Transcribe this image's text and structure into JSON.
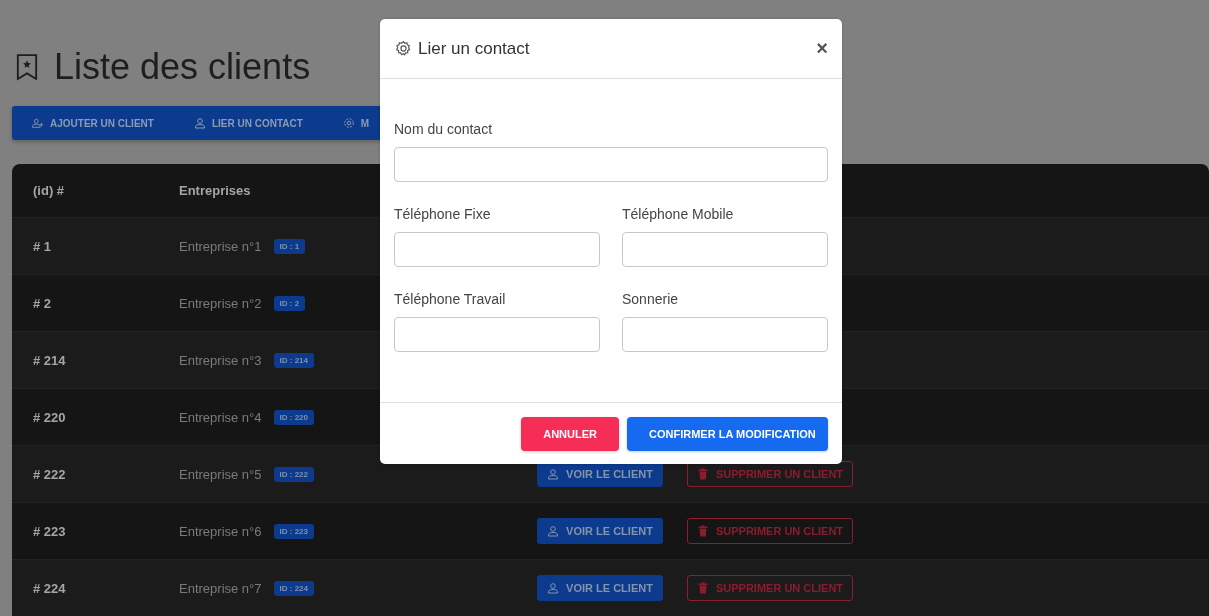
{
  "page": {
    "title": "Liste des clients"
  },
  "toolbar": [
    {
      "kind": "add-user",
      "label": "AJOUTER UN CLIENT"
    },
    {
      "kind": "user",
      "label": "LIER UN CONTACT"
    },
    {
      "kind": "gear",
      "label": "M"
    }
  ],
  "table": {
    "columns": [
      "(id) #",
      "Entreprises"
    ],
    "rows": [
      {
        "id": "# 1",
        "company": "Entreprise n°1",
        "badge": "ID : 1",
        "actions": []
      },
      {
        "id": "# 2",
        "company": "Entreprise n°2",
        "badge": "ID : 2",
        "actions": []
      },
      {
        "id": "# 214",
        "company": "Entreprise n°3",
        "badge": "ID : 214",
        "actions": []
      },
      {
        "id": "# 220",
        "company": "Entreprise n°4",
        "badge": "ID : 220",
        "actions": []
      },
      {
        "id": "# 222",
        "company": "Entreprise n°5",
        "badge": "ID : 222",
        "actions": [
          {
            "kind": "view",
            "label": "VOIR LE CLIENT"
          },
          {
            "kind": "delete",
            "label": "SUPPRIMER UN CLIENT"
          }
        ]
      },
      {
        "id": "# 223",
        "company": "Entreprise n°6",
        "badge": "ID : 223",
        "actions": [
          {
            "kind": "view",
            "label": "VOIR LE CLIENT"
          },
          {
            "kind": "delete",
            "label": "SUPPRIMER UN CLIENT"
          }
        ]
      },
      {
        "id": "# 224",
        "company": "Entreprise n°7",
        "badge": "ID : 224",
        "actions": [
          {
            "kind": "view",
            "label": "VOIR LE CLIENT"
          },
          {
            "kind": "delete",
            "label": "SUPPRIMER UN CLIENT"
          }
        ]
      }
    ]
  },
  "modal": {
    "title": "Lier un contact",
    "close": "×",
    "fields": [
      [
        {
          "label": "Nom du contact"
        }
      ],
      [
        {
          "label": "Téléphone Fixe"
        },
        {
          "label": "Téléphone Mobile"
        }
      ],
      [
        {
          "label": "Téléphone Travail"
        },
        {
          "label": "Sonnerie"
        }
      ]
    ],
    "buttons": [
      {
        "kind": "cancel",
        "label": "ANNULER"
      },
      {
        "kind": "confirm",
        "label": "CONFIRMER LA MODIFICATION"
      }
    ]
  }
}
